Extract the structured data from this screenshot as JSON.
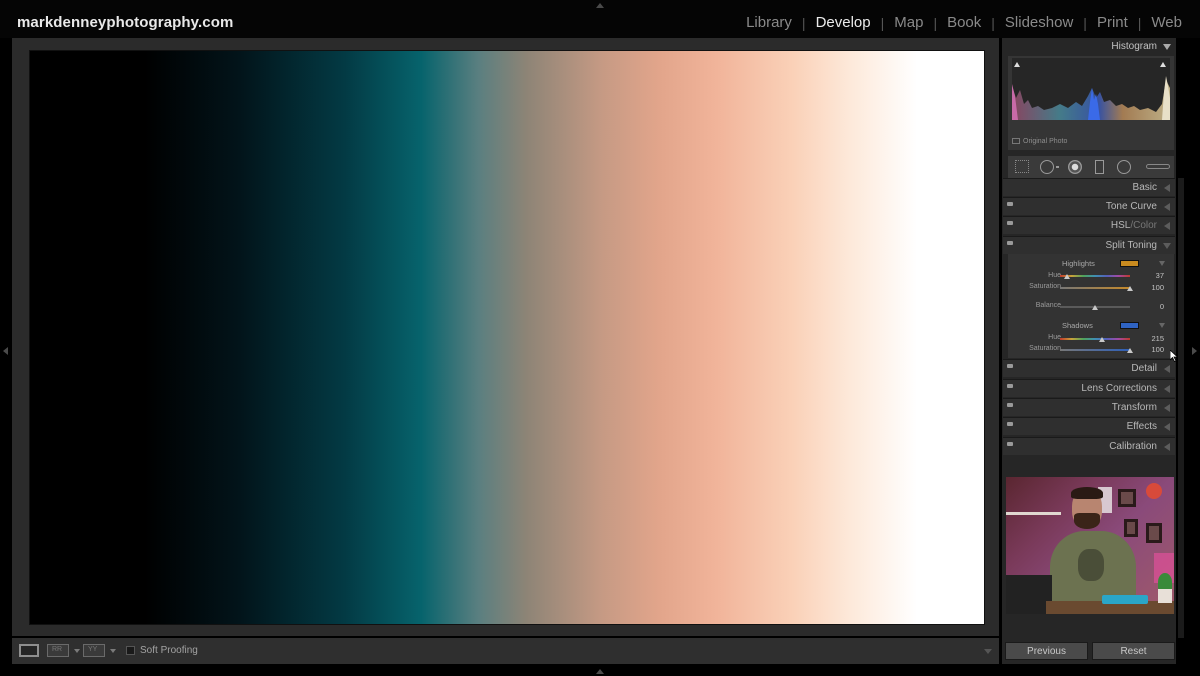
{
  "brand": "markdenneyphotography.com",
  "modules": [
    {
      "label": "Library",
      "active": false
    },
    {
      "label": "Develop",
      "active": true
    },
    {
      "label": "Map",
      "active": false
    },
    {
      "label": "Book",
      "active": false
    },
    {
      "label": "Slideshow",
      "active": false
    },
    {
      "label": "Print",
      "active": false
    },
    {
      "label": "Web",
      "active": false
    }
  ],
  "module_separator": "|",
  "toolbar": {
    "soft_proofing": "Soft Proofing",
    "before_after_label": "RR",
    "yy_label": "YY"
  },
  "histogram": {
    "title": "Histogram",
    "original_photo": "Original Photo"
  },
  "panels": {
    "basic": "Basic",
    "tone_curve": "Tone Curve",
    "hsl": "HSL",
    "hsl_sep": "/",
    "color": "Color",
    "split_toning": "Split Toning",
    "detail": "Detail",
    "lens_corrections": "Lens Corrections",
    "transform": "Transform",
    "effects": "Effects",
    "calibration": "Calibration"
  },
  "split_toning": {
    "highlights": {
      "label": "Highlights",
      "swatch_color": "#c98b1f",
      "hue_label": "Hue",
      "hue_value": "37",
      "hue": 37,
      "saturation_label": "Saturation",
      "saturation_value": "100",
      "saturation": 100
    },
    "balance": {
      "label": "Balance",
      "value_text": "0",
      "value": 0
    },
    "shadows": {
      "label": "Shadows",
      "swatch_color": "#2f63c2",
      "hue_label": "Hue",
      "hue_value": "215",
      "hue": 215,
      "saturation_label": "Saturation",
      "saturation_value": "100",
      "saturation": 100
    }
  },
  "buttons": {
    "previous": "Previous",
    "reset": "Reset"
  },
  "colors": {
    "accent_highlight": "#c98b1f",
    "accent_shadow": "#2f63c2",
    "panel_bg": "#262626"
  },
  "icons": [
    "crop-icon",
    "spot-removal-icon",
    "red-eye-icon",
    "graduated-filter-icon",
    "radial-filter-icon",
    "adjustment-brush-icon"
  ]
}
